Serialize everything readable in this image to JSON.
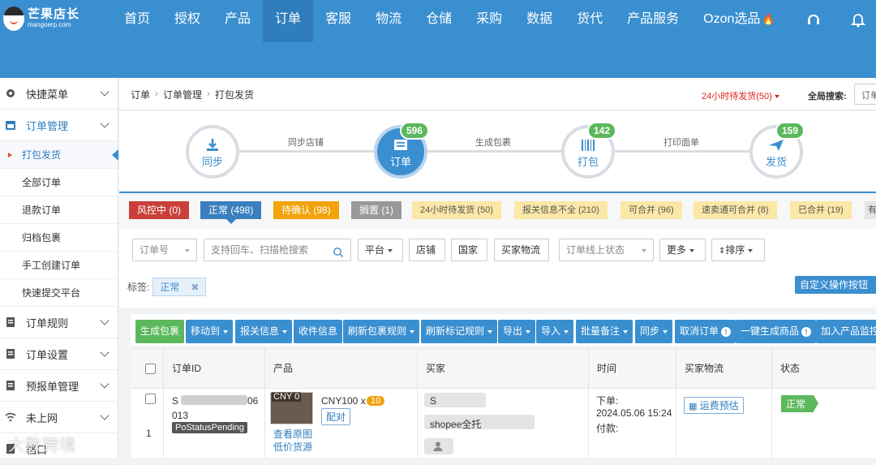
{
  "brand": {
    "name": "芒果店长",
    "url": "mangoerp.com"
  },
  "topnav": [
    {
      "label": "首页"
    },
    {
      "label": "授权"
    },
    {
      "label": "产品"
    },
    {
      "label": "订单"
    },
    {
      "label": "客服"
    },
    {
      "label": "物流"
    },
    {
      "label": "仓储"
    },
    {
      "label": "采购"
    },
    {
      "label": "数据"
    },
    {
      "label": "货代"
    },
    {
      "label": "产品服务"
    },
    {
      "label": "Ozon选品"
    }
  ],
  "sidebar": {
    "groups": [
      {
        "label": "快捷菜单"
      },
      {
        "label": "订单管理"
      },
      {
        "label": "订单规则"
      },
      {
        "label": "订单设置"
      },
      {
        "label": "预报单管理"
      },
      {
        "label": "未上网"
      },
      {
        "label": "档口"
      }
    ],
    "subitems": [
      {
        "label": "打包发货"
      },
      {
        "label": "全部订单"
      },
      {
        "label": "退款订单"
      },
      {
        "label": "归档包裹"
      },
      {
        "label": "手工创建订单"
      },
      {
        "label": "快速提交平台"
      }
    ]
  },
  "breadcrumb": [
    "订单",
    "订单管理",
    "打包发货"
  ],
  "alert_24h": "24小时待发货(50)",
  "global_search": {
    "label": "全局搜索:",
    "value": "订单"
  },
  "steps": [
    {
      "label": "同步",
      "count": ""
    },
    {
      "label": "订单",
      "count": "596"
    },
    {
      "label": "打包",
      "count": "142"
    },
    {
      "label": "发货",
      "count": "159"
    }
  ],
  "connectors": [
    "同步店铺",
    "生成包裹",
    "打印面单"
  ],
  "status_tags": [
    {
      "label": "风控中 (0)",
      "color": "#c9403a"
    },
    {
      "label": "正常 (498)",
      "color": "#3a7fbf"
    },
    {
      "label": "待确认 (98)",
      "color": "#f0a30a"
    },
    {
      "label": "搁置 (1)",
      "color": "#999999"
    },
    {
      "label": "24小时待发货 (50)",
      "color": "#fbe7a6"
    },
    {
      "label": "报关信息不全 (210)",
      "color": "#fbe7a6"
    },
    {
      "label": "可合并 (96)",
      "color": "#fbe7a6"
    },
    {
      "label": "速卖通可合并 (8)",
      "color": "#fbe7a6"
    },
    {
      "label": "已合并 (19)",
      "color": "#fbe7a6"
    },
    {
      "label": "有",
      "color": "#e4e4e4"
    }
  ],
  "filters": {
    "order_no": "订单号",
    "search_placeholder": "支持回车、扫描枪搜索",
    "platform": "平台",
    "shop": "店铺",
    "country": "国家",
    "buyer_logistics": "买家物流",
    "online_status": "订单线上状态",
    "more": "更多",
    "sort": "排序",
    "tags_label": "标签:",
    "tag_chip": "正常",
    "custom_button": "自定义操作按钮"
  },
  "actions": [
    {
      "label": "生成包裹"
    },
    {
      "label": "移动到"
    },
    {
      "label": "报关信息"
    },
    {
      "label": "收件信息"
    },
    {
      "label": "刷新包裹规则"
    },
    {
      "label": "刷新标记规则"
    },
    {
      "label": "导出"
    },
    {
      "label": "导入"
    },
    {
      "label": "批量备注"
    },
    {
      "label": "同步"
    },
    {
      "label": "取消订单"
    },
    {
      "label": "一键生成商品"
    },
    {
      "label": "加入产品监控"
    }
  ],
  "table": {
    "headers": [
      "订单ID",
      "产品",
      "买家",
      "时间",
      "买家物流",
      "状态"
    ],
    "rows": [
      {
        "index": "1",
        "order_id_start": "S",
        "order_id_mid": "06",
        "order_id_end": "013",
        "status_badge": "PoStatusPending",
        "thumb_label": "CNY 0",
        "price": "CNY100 x",
        "qty": "10",
        "pair_btn": "配对",
        "view_image": "查看原图",
        "low_price_source": "低价货源",
        "buyer_name": "S",
        "buyer_store": "shopee全托",
        "order_time_label": "下单:",
        "order_time": "2024.05.06 15:24",
        "pay_label": "付款:",
        "freight_btn": "运费预估",
        "status": "正常"
      }
    ]
  },
  "watermark": "大数跨境"
}
